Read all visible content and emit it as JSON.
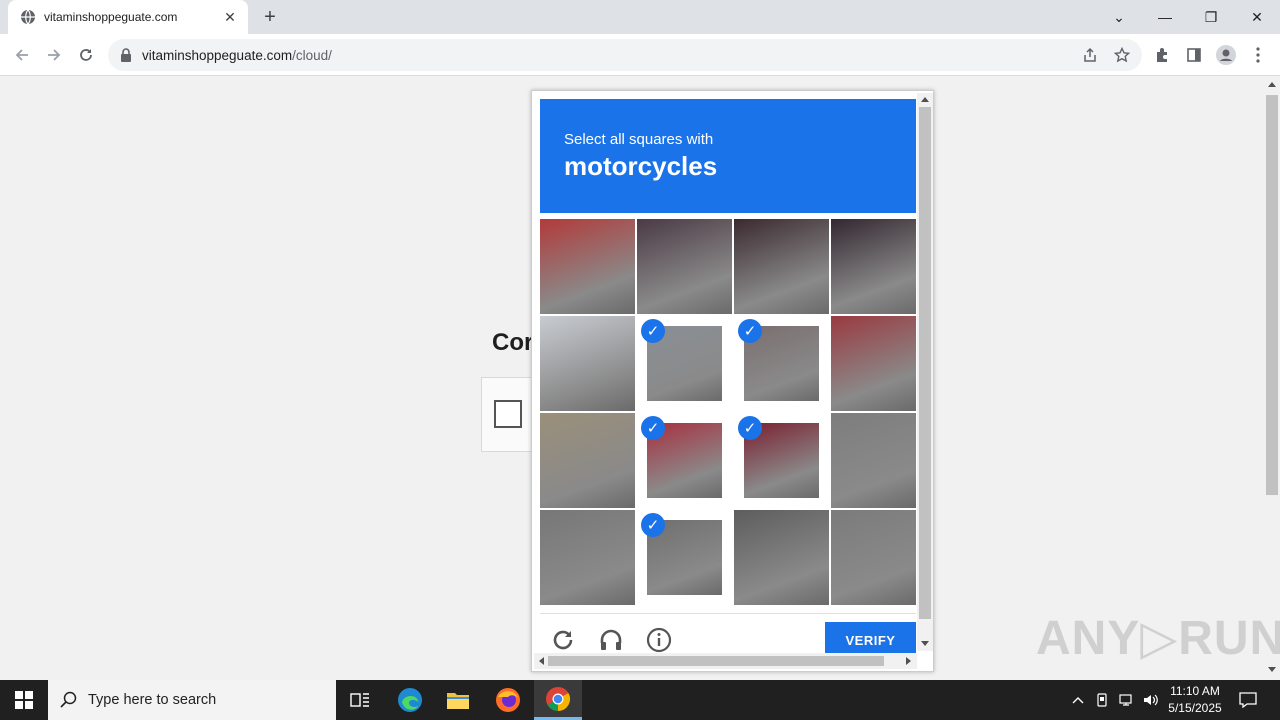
{
  "browser": {
    "tab_title": "vitaminshoppeguate.com",
    "tab_close": "✕",
    "new_tab": "+",
    "url_host": "vitaminshoppeguate.com",
    "url_path": "/cloud/",
    "window_controls": [
      "⌄",
      "—",
      "❐",
      "✕"
    ]
  },
  "page": {
    "heading": "Cor"
  },
  "captcha": {
    "instruction": "Select all squares with",
    "target": "motorcycles",
    "grid_rows": 4,
    "grid_cols": 4,
    "selected_tiles": [
      5,
      6,
      9,
      10,
      13
    ],
    "checkmark": "✓",
    "verify_label": "VERIFY",
    "footer_icons": [
      "reload-icon",
      "audio-icon",
      "info-icon"
    ],
    "accent_color": "#1a73e8"
  },
  "watermark": "ANY▷RUN",
  "taskbar": {
    "search_placeholder": "Type here to search",
    "apps": [
      "task-view-icon",
      "edge-icon",
      "file-explorer-icon",
      "firefox-icon",
      "chrome-icon"
    ],
    "active_app": "chrome-icon",
    "time": "11:10 AM",
    "date": "5/15/2025"
  }
}
